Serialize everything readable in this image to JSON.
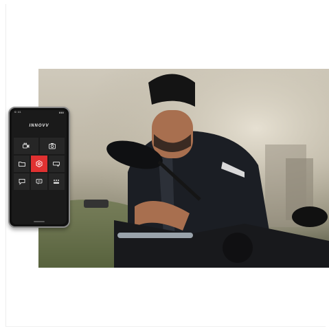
{
  "app": {
    "brand": "INNOVV",
    "status_left": "9:41",
    "status_right": "▮▮▮"
  },
  "menu": {
    "row1": [
      {
        "icon": "video-camera-icon"
      },
      {
        "icon": "photo-camera-icon"
      }
    ],
    "row2": [
      {
        "icon": "folder-icon"
      },
      {
        "icon": "settings-hexagon-icon",
        "active": true
      },
      {
        "icon": "device-icon"
      }
    ],
    "row3": [
      {
        "icon": "chat-bubble-icon"
      },
      {
        "icon": "message-icon"
      },
      {
        "icon": "apps-grid-icon"
      }
    ]
  },
  "colors": {
    "accent": "#e03131",
    "tile": "#262626",
    "phone_body": "#101010"
  }
}
